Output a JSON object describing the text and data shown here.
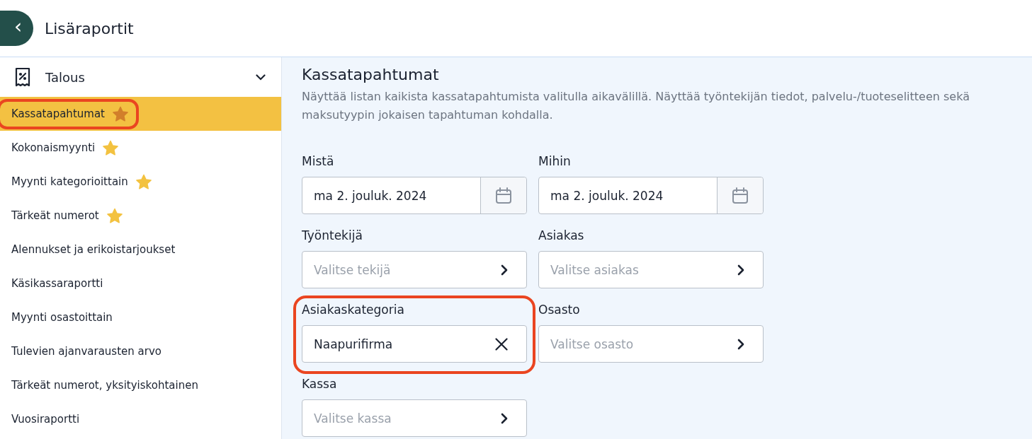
{
  "header": {
    "back_icon": "‹",
    "title": "Lisäraportit"
  },
  "sidebar": {
    "group": {
      "label": "Talous",
      "expanded": true
    },
    "items": [
      {
        "label": "Kassatapahtumat",
        "starred": true,
        "selected": true,
        "highlighted": true
      },
      {
        "label": "Kokonaismyynti",
        "starred": true,
        "selected": false,
        "highlighted": false
      },
      {
        "label": "Myynti kategorioittain",
        "starred": true,
        "selected": false,
        "highlighted": false
      },
      {
        "label": "Tärkeät numerot",
        "starred": true,
        "selected": false,
        "highlighted": false
      },
      {
        "label": "Alennukset ja erikoistarjoukset",
        "starred": false,
        "selected": false,
        "highlighted": false
      },
      {
        "label": "Käsikassaraportti",
        "starred": false,
        "selected": false,
        "highlighted": false
      },
      {
        "label": "Myynti osastoittain",
        "starred": false,
        "selected": false,
        "highlighted": false
      },
      {
        "label": "Tulevien ajanvarausten arvo",
        "starred": false,
        "selected": false,
        "highlighted": false
      },
      {
        "label": "Tärkeät numerot, yksityiskohtainen",
        "starred": false,
        "selected": false,
        "highlighted": false
      },
      {
        "label": "Vuosiraportti",
        "starred": false,
        "selected": false,
        "highlighted": false
      }
    ]
  },
  "report": {
    "title": "Kassatapahtumat",
    "description": "Näyttää listan kaikista kassatapahtumista valitulla aikavälillä. Näyttää työntekijän tiedot, palvelu-/tuoteselitteen sekä maksutyypin jokaisen tapahtuman kohdalla.",
    "fields": [
      {
        "label": "Mistä",
        "kind": "date",
        "value": "ma 2. jouluk. 2024",
        "highlighted": false
      },
      {
        "label": "Mihin",
        "kind": "date",
        "value": "ma 2. jouluk. 2024",
        "highlighted": false
      },
      {
        "label": "Työntekijä",
        "kind": "select",
        "placeholder": "Valitse tekijä",
        "highlighted": false
      },
      {
        "label": "Asiakas",
        "kind": "select",
        "placeholder": "Valitse asiakas",
        "highlighted": false
      },
      {
        "label": "Asiakaskategoria",
        "kind": "select",
        "value": "Naapurifirma",
        "highlighted": true
      },
      {
        "label": "Osasto",
        "kind": "select",
        "placeholder": "Valitse osasto",
        "highlighted": false
      },
      {
        "label": "Kassa",
        "kind": "select",
        "placeholder": "Valitse kassa",
        "highlighted": false
      }
    ]
  }
}
